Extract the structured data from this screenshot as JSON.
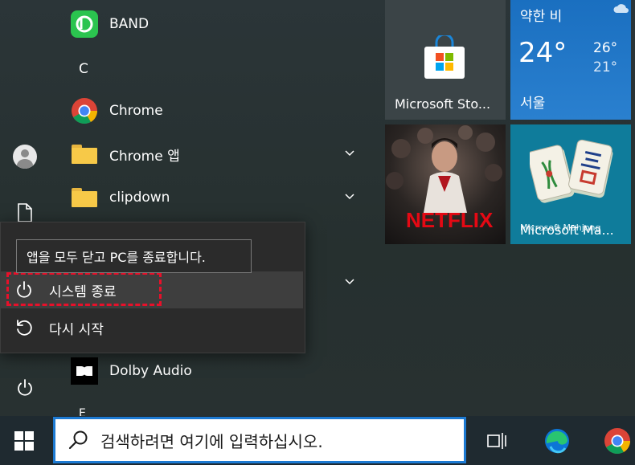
{
  "start_menu": {
    "apps": [
      {
        "label": "BAND",
        "icon": "band-icon"
      },
      {
        "label": "Chrome",
        "icon": "chrome-icon"
      },
      {
        "label": "Chrome 앱",
        "icon": "folder-icon",
        "expandable": true
      },
      {
        "label": "clipdown",
        "icon": "folder-icon",
        "expandable": true
      },
      {
        "label": "Dolby Audio",
        "icon": "dolby-icon"
      }
    ],
    "section_letters": [
      "C",
      "E"
    ]
  },
  "tiles": {
    "store": {
      "label": "Microsoft Sto..."
    },
    "weather": {
      "condition": "약한 비",
      "temp": "24°",
      "high": "26°",
      "low": "21°",
      "city": "서울"
    },
    "netflix": {
      "logo": "NETFLIX"
    },
    "mahjong": {
      "label": "Microsoft Ma...",
      "logo_text": "Microsoft Mahjong"
    }
  },
  "power_menu": {
    "tooltip": "앱을 모두 닫고 PC를 종료합니다.",
    "shutdown_label": "시스템 종료",
    "restart_label": "다시 시작"
  },
  "taskbar": {
    "search_placeholder": "검색하려면 여기에 입력하십시오."
  },
  "colors": {
    "accent": "#1d7ad2",
    "highlight_border": "#e8102a",
    "weather_tile": "#1d7ad2",
    "mahjong_tile": "#0f7c9b"
  }
}
